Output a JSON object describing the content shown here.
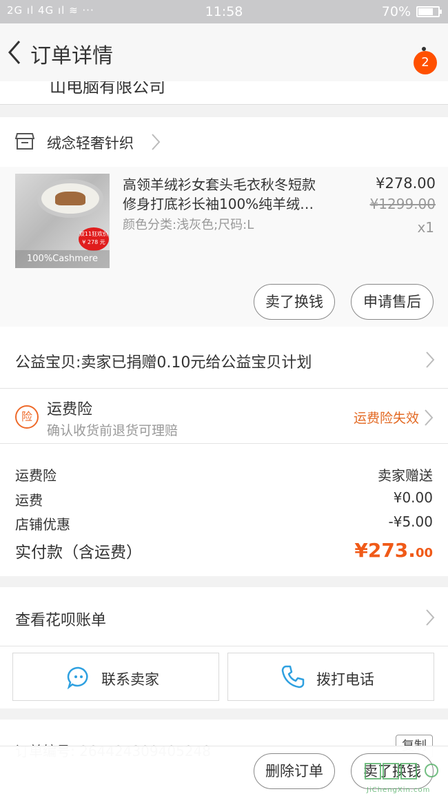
{
  "status_bar": {
    "signal_text": "2G ıl 4G ıl ≋ ···",
    "time": "11:58",
    "battery_percent": "70%",
    "battery_level": 0.7
  },
  "nav": {
    "title": "订单详情",
    "badge_count": "2",
    "back_icon": "chevron-left-icon",
    "more_icon": "more-vertical-icon"
  },
  "address_cut_text": "山电脑有限公司",
  "shop": {
    "name": "绒念轻奢针织",
    "icon": "store-icon"
  },
  "item": {
    "title_line1": "高领羊绒衫女套头毛衣秋冬短款",
    "title_line2": "修身打底衫长袖100%纯羊绒…",
    "sku": "颜色分类:浅灰色;尺码:L",
    "price": "¥278.00",
    "original_price": "¥1299.00",
    "quantity": "x1",
    "image_caption": "100%Cashmere",
    "image_promo_line1": "双11狂欢价",
    "image_promo_line2": "¥ 278 元",
    "sell_button": "卖了换钱",
    "aftersale_button": "申请售后"
  },
  "charity": {
    "text": "公益宝贝:卖家已捐赠0.10元给公益宝贝计划"
  },
  "insurance": {
    "icon_text": "险",
    "title": "运费险",
    "subtitle": "确认收货前退货可理赔",
    "status": "运费险失效"
  },
  "fees": [
    {
      "label": "运费险",
      "value": "卖家赠送"
    },
    {
      "label": "运费",
      "value": "¥0.00"
    },
    {
      "label": "店铺优惠",
      "value": "-¥5.00"
    }
  ],
  "total": {
    "label": "实付款（含运费）",
    "value_main": "¥273.",
    "value_cents": "00"
  },
  "huabei": {
    "text": "查看花呗账单"
  },
  "contact": {
    "seller_label": "联系卖家",
    "call_label": "拨打电话"
  },
  "order": {
    "number_text": "订单编号: 264424309405248",
    "copy_label": "复制"
  },
  "bottom_bar": {
    "delete_label": "删除订单",
    "sell_label": "卖了换钱"
  },
  "watermark": {
    "text": "JiChengXin.com"
  },
  "colors": {
    "accent_orange": "#ff5000",
    "price_orange": "#f05a18",
    "contact_blue": "#2ea0e0"
  }
}
